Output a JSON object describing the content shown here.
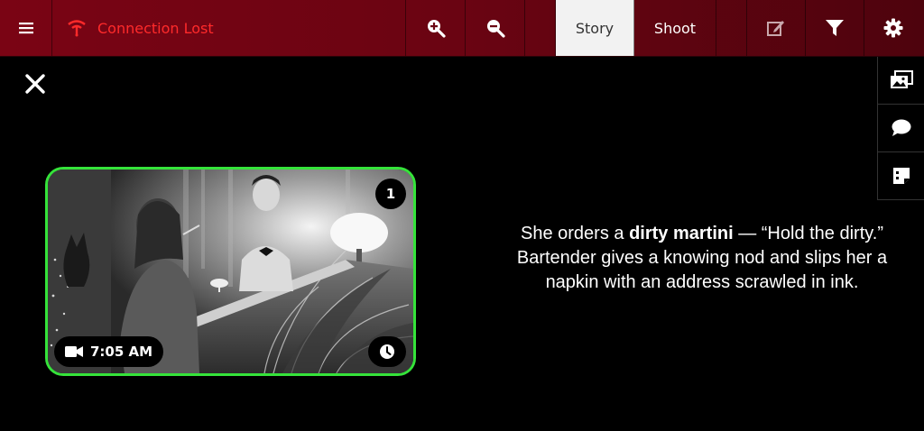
{
  "toolbar": {
    "menu_icon": "hamburger-icon",
    "status": {
      "icon": "connection-lost-icon",
      "text": "Connection Lost",
      "color": "#ff2a2a"
    },
    "zoom_in_icon": "zoom-in-icon",
    "zoom_out_icon": "zoom-out-icon",
    "tabs": [
      {
        "label": "Story",
        "active": true
      },
      {
        "label": "Shoot",
        "active": false
      }
    ],
    "tools": [
      "edit-icon",
      "filter-icon",
      "gear-icon"
    ]
  },
  "close_icon": "close-icon",
  "side_rail": [
    "images-icon",
    "comment-icon",
    "notes-icon"
  ],
  "panel": {
    "number": "1",
    "time": "7:05 AM",
    "time_icon": "video-camera-icon",
    "clock_icon": "clock-icon",
    "border_color": "#35e33a"
  },
  "description": {
    "before": "She orders a ",
    "bold": "dirty martini",
    "after": " — “Hold the dirty.” Bartender gives a knowing nod and slips her a napkin with an address scrawled in ink."
  }
}
